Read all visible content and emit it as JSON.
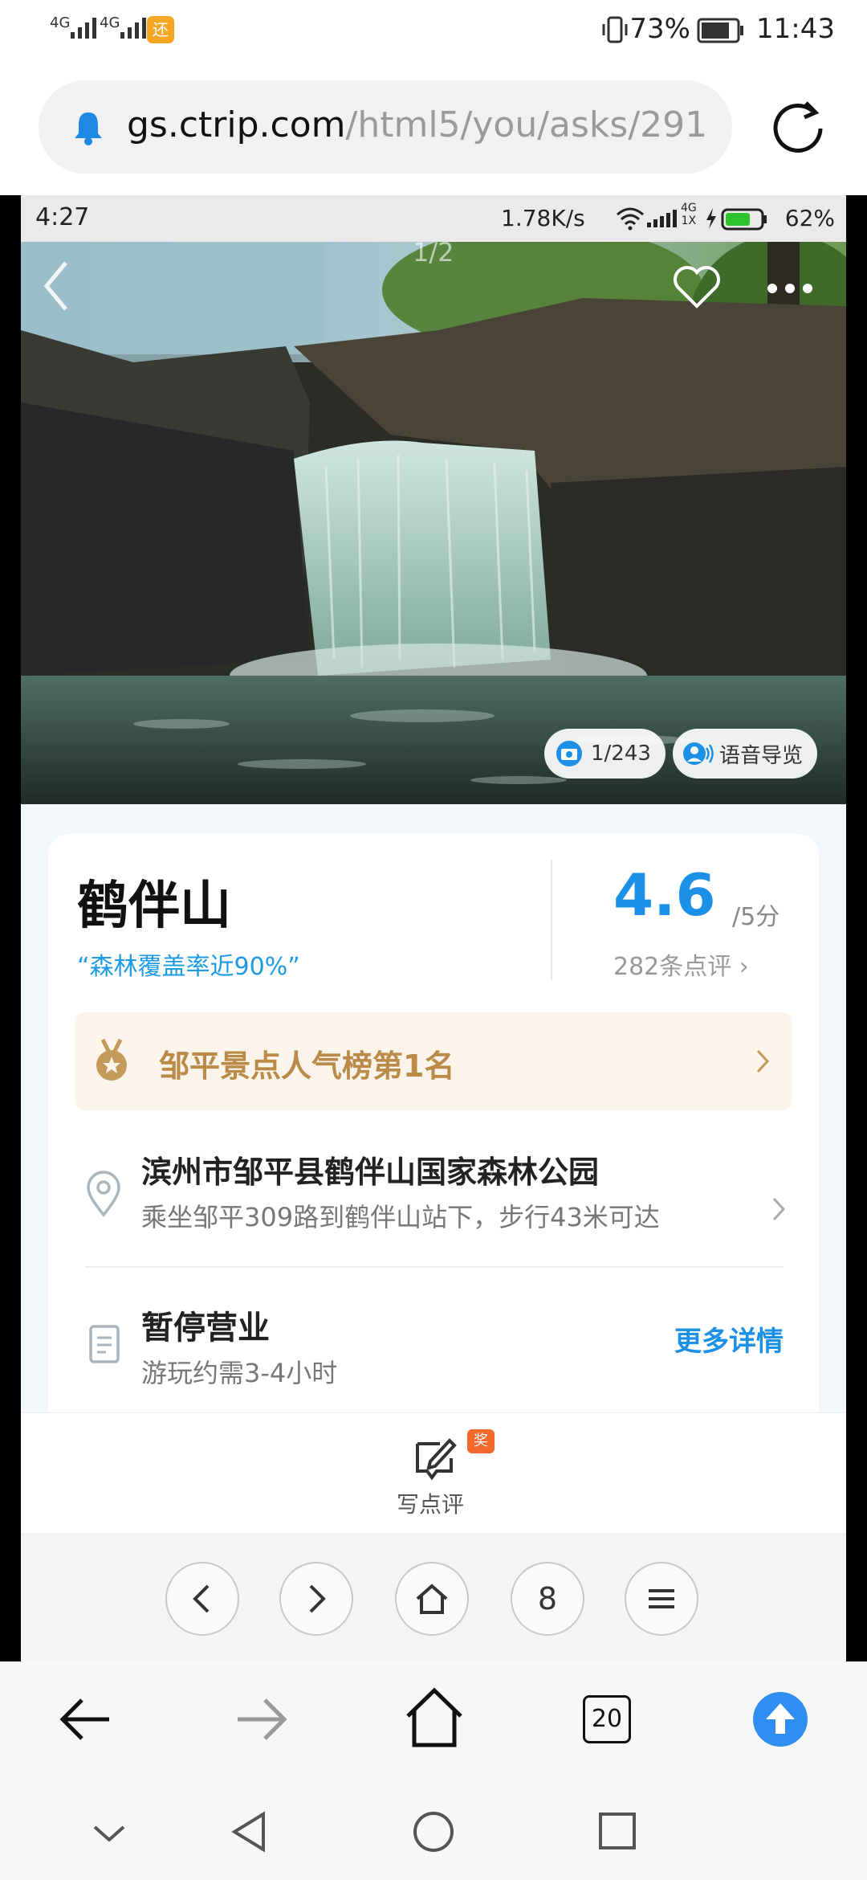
{
  "outer_status": {
    "network_1": "4G",
    "network_2": "4G",
    "app_badge": "还",
    "battery": "73%",
    "time": "11:43"
  },
  "url_bar": {
    "domain": "gs.ctrip.com",
    "path": "/html5/you/asks/291"
  },
  "inner_status": {
    "time": "4:27",
    "speed": "1.78K/s",
    "net_top": "4G",
    "net_bottom": "1X",
    "battery": "62%"
  },
  "hero": {
    "image_desc": "waterfall",
    "page_indicator": "1/2",
    "photo_count": "1/243",
    "audio_guide": "语音导览"
  },
  "card": {
    "name": "鹤伴山",
    "slogan": "“森林覆盖率近90%”",
    "score": "4.6",
    "score_unit": "/5分",
    "reviews": "282条点评 ›",
    "rank": "邹平景点人气榜第1名",
    "address_title": "滨州市邹平县鹤伴山国家森林公园",
    "address_sub": "乘坐邹平309路到鹤伴山站下，步行43米可达",
    "hours_title": "暂停营业",
    "hours_sub": "游玩约需3-4小时",
    "more_details": "更多详情"
  },
  "review_bar": {
    "label": "写点评",
    "badge": "奖"
  },
  "inner_nav": {
    "tabs_count": "8"
  },
  "browser_bar": {
    "tab_count": "20"
  },
  "colors": {
    "accent": "#1c8fe6",
    "rank_text": "#b98a48",
    "rank_bg": "#fbf4ea",
    "upload_btn": "#2f8ff0"
  }
}
